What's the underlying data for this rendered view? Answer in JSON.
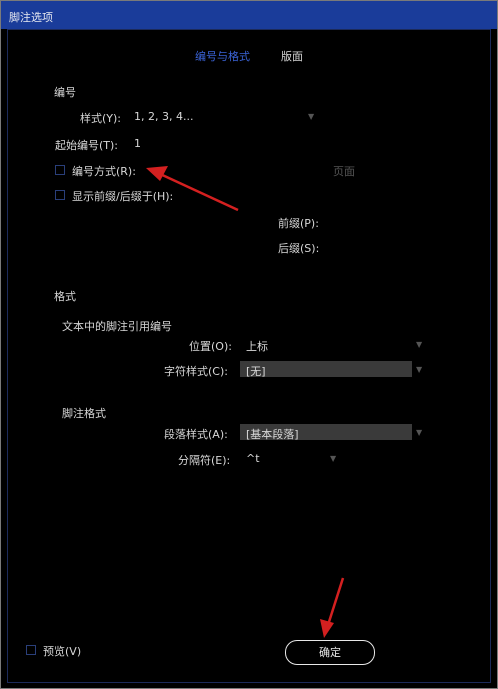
{
  "window": {
    "title": "脚注选项"
  },
  "tabs": [
    {
      "label": "编号与格式"
    },
    {
      "label": "版面"
    }
  ],
  "numbering": {
    "section_label": "编号",
    "style_label": "样式(Y):",
    "style_value": "1, 2, 3, 4...",
    "start_label": "起始编号(T):",
    "start_value": "1",
    "restart_label": "编号方式(R):",
    "restart_value": "页面",
    "prefix_suffix_label": "显示前缀/后缀于(H):",
    "prefix_label": "前缀(P):",
    "suffix_label": "后缀(S):"
  },
  "format": {
    "section_label": "格式",
    "ref_group_label": "文本中的脚注引用编号",
    "position_label": "位置(O):",
    "position_value": "上标",
    "char_style_label": "字符样式(C):",
    "char_style_value": "[无]",
    "footnote_group_label": "脚注格式",
    "para_style_label": "段落样式(A):",
    "para_style_value": "[基本段落]",
    "separator_label": "分隔符(E):",
    "separator_value": "^t"
  },
  "footer": {
    "preview_label": "预览(V)",
    "ok_label": "确定"
  },
  "colors": {
    "title_bar": "#1a3c9a",
    "active_tab": "#3a63d6",
    "annotation_arrow": "#d42020"
  }
}
